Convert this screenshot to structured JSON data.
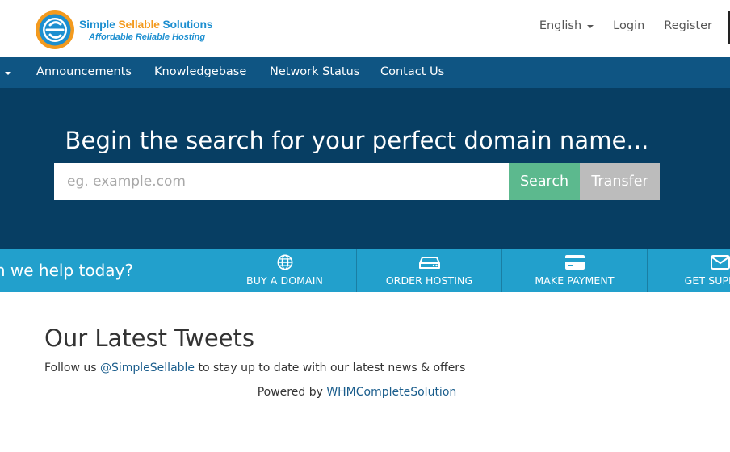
{
  "brand": {
    "name_part1": "Simple ",
    "name_part2": "Sellable",
    "name_part3": " Solutions",
    "tagline": "Affordable Reliable Hosting",
    "colors": {
      "blue": "#1d8fd0",
      "orange": "#f39a1e"
    }
  },
  "top_nav": {
    "language": "English",
    "login": "Login",
    "register": "Register"
  },
  "main_nav": {
    "items": [
      "Announcements",
      "Knowledgebase",
      "Network Status",
      "Contact Us"
    ]
  },
  "hero": {
    "title": "Begin the search for your perfect domain name...",
    "search_placeholder": "eg. example.com",
    "search_button": "Search",
    "transfer_button": "Transfer",
    "colors": {
      "background": "#073e63",
      "search": "#5cb98e",
      "transfer": "#bcbcbc"
    }
  },
  "help_bar": {
    "prompt": "How can we help today?",
    "actions": [
      {
        "label": "BUY A DOMAIN",
        "icon": "globe-icon"
      },
      {
        "label": "ORDER HOSTING",
        "icon": "server-icon"
      },
      {
        "label": "MAKE PAYMENT",
        "icon": "credit-card-icon"
      },
      {
        "label": "GET SUPPORT",
        "icon": "envelope-icon"
      }
    ],
    "color": "#22a0cc"
  },
  "tweets": {
    "title": "Our Latest Tweets",
    "follow_prefix": "Follow us ",
    "handle": "@SimpleSellable",
    "follow_suffix": " to stay up to date with our latest news & offers"
  },
  "footer": {
    "powered_prefix": "Powered by ",
    "powered_link": "WHMCompleteSolution"
  },
  "nav_color": "#0f5583"
}
